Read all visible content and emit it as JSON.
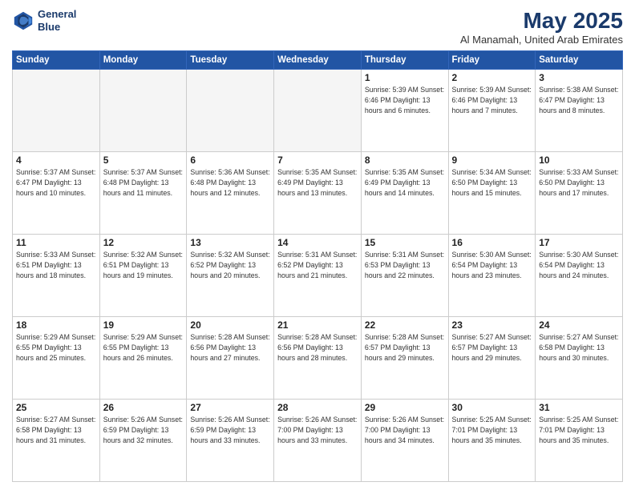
{
  "header": {
    "logo_line1": "General",
    "logo_line2": "Blue",
    "month": "May 2025",
    "location": "Al Manamah, United Arab Emirates"
  },
  "days_of_week": [
    "Sunday",
    "Monday",
    "Tuesday",
    "Wednesday",
    "Thursday",
    "Friday",
    "Saturday"
  ],
  "weeks": [
    [
      {
        "day": "",
        "info": ""
      },
      {
        "day": "",
        "info": ""
      },
      {
        "day": "",
        "info": ""
      },
      {
        "day": "",
        "info": ""
      },
      {
        "day": "1",
        "info": "Sunrise: 5:39 AM\nSunset: 6:46 PM\nDaylight: 13 hours\nand 6 minutes."
      },
      {
        "day": "2",
        "info": "Sunrise: 5:39 AM\nSunset: 6:46 PM\nDaylight: 13 hours\nand 7 minutes."
      },
      {
        "day": "3",
        "info": "Sunrise: 5:38 AM\nSunset: 6:47 PM\nDaylight: 13 hours\nand 8 minutes."
      }
    ],
    [
      {
        "day": "4",
        "info": "Sunrise: 5:37 AM\nSunset: 6:47 PM\nDaylight: 13 hours\nand 10 minutes."
      },
      {
        "day": "5",
        "info": "Sunrise: 5:37 AM\nSunset: 6:48 PM\nDaylight: 13 hours\nand 11 minutes."
      },
      {
        "day": "6",
        "info": "Sunrise: 5:36 AM\nSunset: 6:48 PM\nDaylight: 13 hours\nand 12 minutes."
      },
      {
        "day": "7",
        "info": "Sunrise: 5:35 AM\nSunset: 6:49 PM\nDaylight: 13 hours\nand 13 minutes."
      },
      {
        "day": "8",
        "info": "Sunrise: 5:35 AM\nSunset: 6:49 PM\nDaylight: 13 hours\nand 14 minutes."
      },
      {
        "day": "9",
        "info": "Sunrise: 5:34 AM\nSunset: 6:50 PM\nDaylight: 13 hours\nand 15 minutes."
      },
      {
        "day": "10",
        "info": "Sunrise: 5:33 AM\nSunset: 6:50 PM\nDaylight: 13 hours\nand 17 minutes."
      }
    ],
    [
      {
        "day": "11",
        "info": "Sunrise: 5:33 AM\nSunset: 6:51 PM\nDaylight: 13 hours\nand 18 minutes."
      },
      {
        "day": "12",
        "info": "Sunrise: 5:32 AM\nSunset: 6:51 PM\nDaylight: 13 hours\nand 19 minutes."
      },
      {
        "day": "13",
        "info": "Sunrise: 5:32 AM\nSunset: 6:52 PM\nDaylight: 13 hours\nand 20 minutes."
      },
      {
        "day": "14",
        "info": "Sunrise: 5:31 AM\nSunset: 6:52 PM\nDaylight: 13 hours\nand 21 minutes."
      },
      {
        "day": "15",
        "info": "Sunrise: 5:31 AM\nSunset: 6:53 PM\nDaylight: 13 hours\nand 22 minutes."
      },
      {
        "day": "16",
        "info": "Sunrise: 5:30 AM\nSunset: 6:54 PM\nDaylight: 13 hours\nand 23 minutes."
      },
      {
        "day": "17",
        "info": "Sunrise: 5:30 AM\nSunset: 6:54 PM\nDaylight: 13 hours\nand 24 minutes."
      }
    ],
    [
      {
        "day": "18",
        "info": "Sunrise: 5:29 AM\nSunset: 6:55 PM\nDaylight: 13 hours\nand 25 minutes."
      },
      {
        "day": "19",
        "info": "Sunrise: 5:29 AM\nSunset: 6:55 PM\nDaylight: 13 hours\nand 26 minutes."
      },
      {
        "day": "20",
        "info": "Sunrise: 5:28 AM\nSunset: 6:56 PM\nDaylight: 13 hours\nand 27 minutes."
      },
      {
        "day": "21",
        "info": "Sunrise: 5:28 AM\nSunset: 6:56 PM\nDaylight: 13 hours\nand 28 minutes."
      },
      {
        "day": "22",
        "info": "Sunrise: 5:28 AM\nSunset: 6:57 PM\nDaylight: 13 hours\nand 29 minutes."
      },
      {
        "day": "23",
        "info": "Sunrise: 5:27 AM\nSunset: 6:57 PM\nDaylight: 13 hours\nand 29 minutes."
      },
      {
        "day": "24",
        "info": "Sunrise: 5:27 AM\nSunset: 6:58 PM\nDaylight: 13 hours\nand 30 minutes."
      }
    ],
    [
      {
        "day": "25",
        "info": "Sunrise: 5:27 AM\nSunset: 6:58 PM\nDaylight: 13 hours\nand 31 minutes."
      },
      {
        "day": "26",
        "info": "Sunrise: 5:26 AM\nSunset: 6:59 PM\nDaylight: 13 hours\nand 32 minutes."
      },
      {
        "day": "27",
        "info": "Sunrise: 5:26 AM\nSunset: 6:59 PM\nDaylight: 13 hours\nand 33 minutes."
      },
      {
        "day": "28",
        "info": "Sunrise: 5:26 AM\nSunset: 7:00 PM\nDaylight: 13 hours\nand 33 minutes."
      },
      {
        "day": "29",
        "info": "Sunrise: 5:26 AM\nSunset: 7:00 PM\nDaylight: 13 hours\nand 34 minutes."
      },
      {
        "day": "30",
        "info": "Sunrise: 5:25 AM\nSunset: 7:01 PM\nDaylight: 13 hours\nand 35 minutes."
      },
      {
        "day": "31",
        "info": "Sunrise: 5:25 AM\nSunset: 7:01 PM\nDaylight: 13 hours\nand 35 minutes."
      }
    ]
  ]
}
